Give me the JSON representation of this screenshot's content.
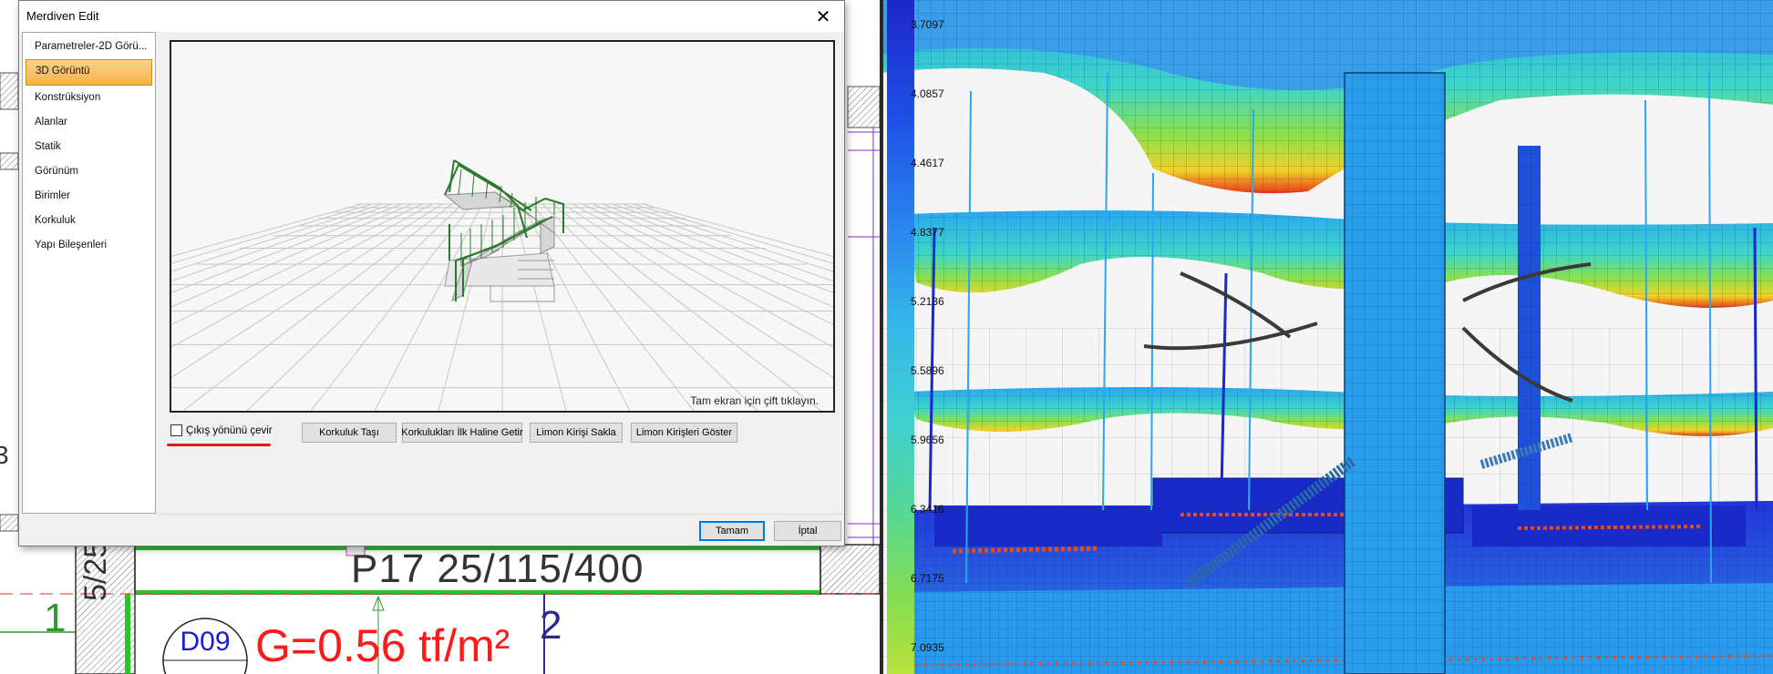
{
  "dialog": {
    "title": "Merdiven Edit",
    "close_glyph": "✕",
    "nav_items": [
      {
        "label": "Parametreler-2D Görü..."
      },
      {
        "label": "3D Görüntü"
      },
      {
        "label": "Konstrüksiyon"
      },
      {
        "label": "Alanlar"
      },
      {
        "label": "Statik"
      },
      {
        "label": "Görünüm"
      },
      {
        "label": "Birimler"
      },
      {
        "label": "Korkuluk"
      },
      {
        "label": "Yapı Bileşenleri"
      }
    ],
    "selected_nav": "3D Görüntü",
    "view_hint": "Tam ekran için çift tıklayın.",
    "checkbox_label": "Çıkış yönünü çevir",
    "checkbox_checked": false,
    "buttons": {
      "move_railing": "Korkuluk Taşı",
      "reset_railings": "Korkulukları İlk Haline Getir",
      "hide_stringer": "Limon Kirişi Sakla",
      "show_stringers": "Limon Kirişleri Göster",
      "ok": "Tamam",
      "cancel": "İptal"
    }
  },
  "cad": {
    "beam_label": "P17 25/115/400",
    "axis_1": "1",
    "axis_2": "2",
    "slab_code": "D09",
    "load_text": "G=0.56 tf/m²",
    "column_label": "5/25",
    "left_fragment": "3"
  },
  "fem": {
    "legend_values": [
      "3.7097",
      "4.0857",
      "4.4617",
      "4.8377",
      "5.2136",
      "5.5896",
      "5.9656",
      "6.3416",
      "6.7175",
      "7.0935"
    ]
  },
  "colors": {
    "accent_selected": "#f5b24a",
    "highlight_underline": "#e21b1b",
    "load_text": "#ff1a1a",
    "slab_code": "#1a1ad8",
    "fem_blue": "#1e26c8",
    "fem_cyan": "#2ab0f0"
  }
}
